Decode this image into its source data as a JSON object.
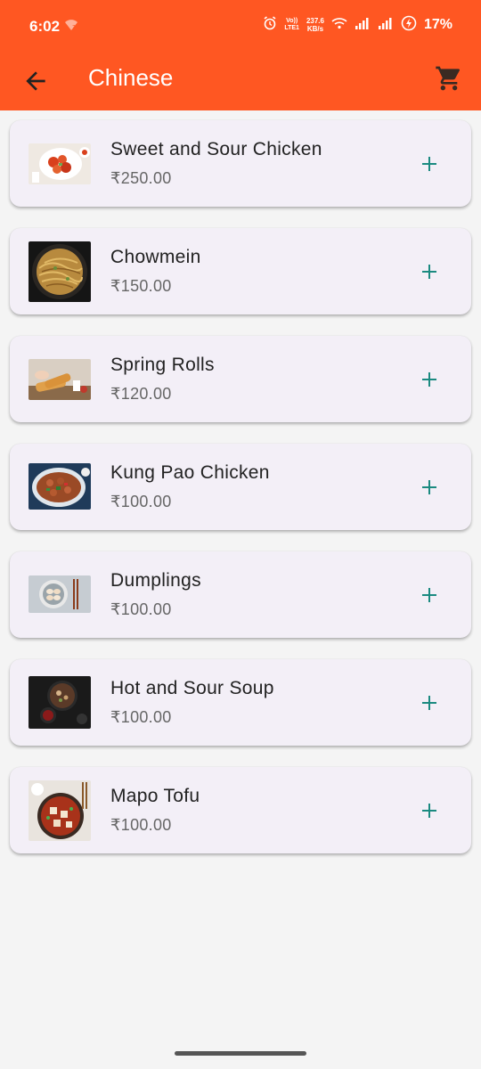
{
  "status_bar": {
    "time": "6:02",
    "network_speed_value": "237.6",
    "network_speed_unit": "KB/s",
    "volte_top": "Vo))",
    "volte_bottom": "LTE1",
    "battery": "17%",
    "icons": [
      "wifi-notification-icon",
      "alarm-icon",
      "volte-icon",
      "wifi-icon",
      "signal-icon",
      "signal-icon",
      "battery-charging-icon"
    ]
  },
  "appbar": {
    "title": "Chinese",
    "back_icon": "arrow-back-icon",
    "cart_icon": "shopping-cart-icon",
    "color": "#ff5722"
  },
  "items": [
    {
      "name": "Sweet and Sour Chicken",
      "price": "₹250.00"
    },
    {
      "name": "Chowmein",
      "price": "₹150.00"
    },
    {
      "name": "Spring Rolls",
      "price": "₹120.00"
    },
    {
      "name": "Kung Pao Chicken",
      "price": "₹100.00"
    },
    {
      "name": "Dumplings",
      "price": "₹100.00"
    },
    {
      "name": "Hot and Sour Soup",
      "price": "₹100.00"
    },
    {
      "name": "Mapo Tofu",
      "price": "₹100.00"
    }
  ],
  "colors": {
    "accent": "#ff5722",
    "add_icon": "#1a8a80",
    "card": "#f3eff7",
    "background": "#f4f4f4"
  }
}
